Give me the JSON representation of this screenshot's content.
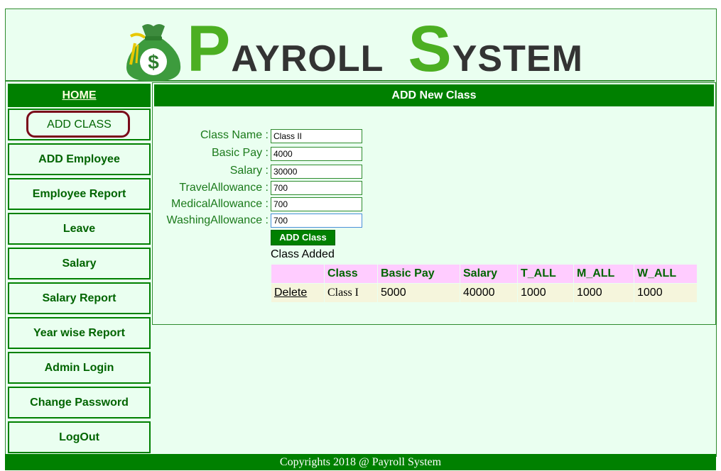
{
  "header": {
    "logo_icon": "money-bag-icon",
    "title_p_cap": "P",
    "title_p_rest": "AYROLL",
    "title_s_cap": "S",
    "title_s_rest": "YSTEM"
  },
  "sidebar": {
    "home_label": "HOME",
    "items": [
      {
        "label": "ADD CLASS",
        "active": true
      },
      {
        "label": "ADD Employee"
      },
      {
        "label": "Employee Report"
      },
      {
        "label": "Leave"
      },
      {
        "label": "Salary"
      },
      {
        "label": "Salary Report"
      },
      {
        "label": "Year wise Report"
      },
      {
        "label": "Admin Login"
      },
      {
        "label": "Change Password"
      },
      {
        "label": "LogOut"
      }
    ]
  },
  "main": {
    "title": "ADD New Class",
    "form": {
      "fields": [
        {
          "label": "Class Name :",
          "value": "Class II"
        },
        {
          "label": "Basic Pay :",
          "value": "4000"
        },
        {
          "label": "Salary :",
          "value": "30000"
        },
        {
          "label": "TravelAllowance :",
          "value": "700"
        },
        {
          "label": "MedicalAllowance :",
          "value": "700"
        },
        {
          "label": "WashingAllowance :",
          "value": "700"
        }
      ],
      "submit_label": "ADD Class"
    },
    "status_message": "Class Added",
    "table": {
      "headers": [
        "",
        "Class",
        "Basic Pay",
        "Salary",
        "T_ALL",
        "M_ALL",
        "W_ALL"
      ],
      "rows": [
        {
          "action": "Delete",
          "class": "Class I",
          "basic_pay": "5000",
          "salary": "40000",
          "t_all": "1000",
          "m_all": "1000",
          "w_all": "1000"
        }
      ]
    }
  },
  "footer": {
    "text": "Copyrights 2018 @ Payroll System"
  },
  "colors": {
    "primary_green": "#008000",
    "background": "#eafff0",
    "table_header": "#ffccff",
    "table_row": "#f5f5dc",
    "active_ring": "#7a0a1a"
  }
}
